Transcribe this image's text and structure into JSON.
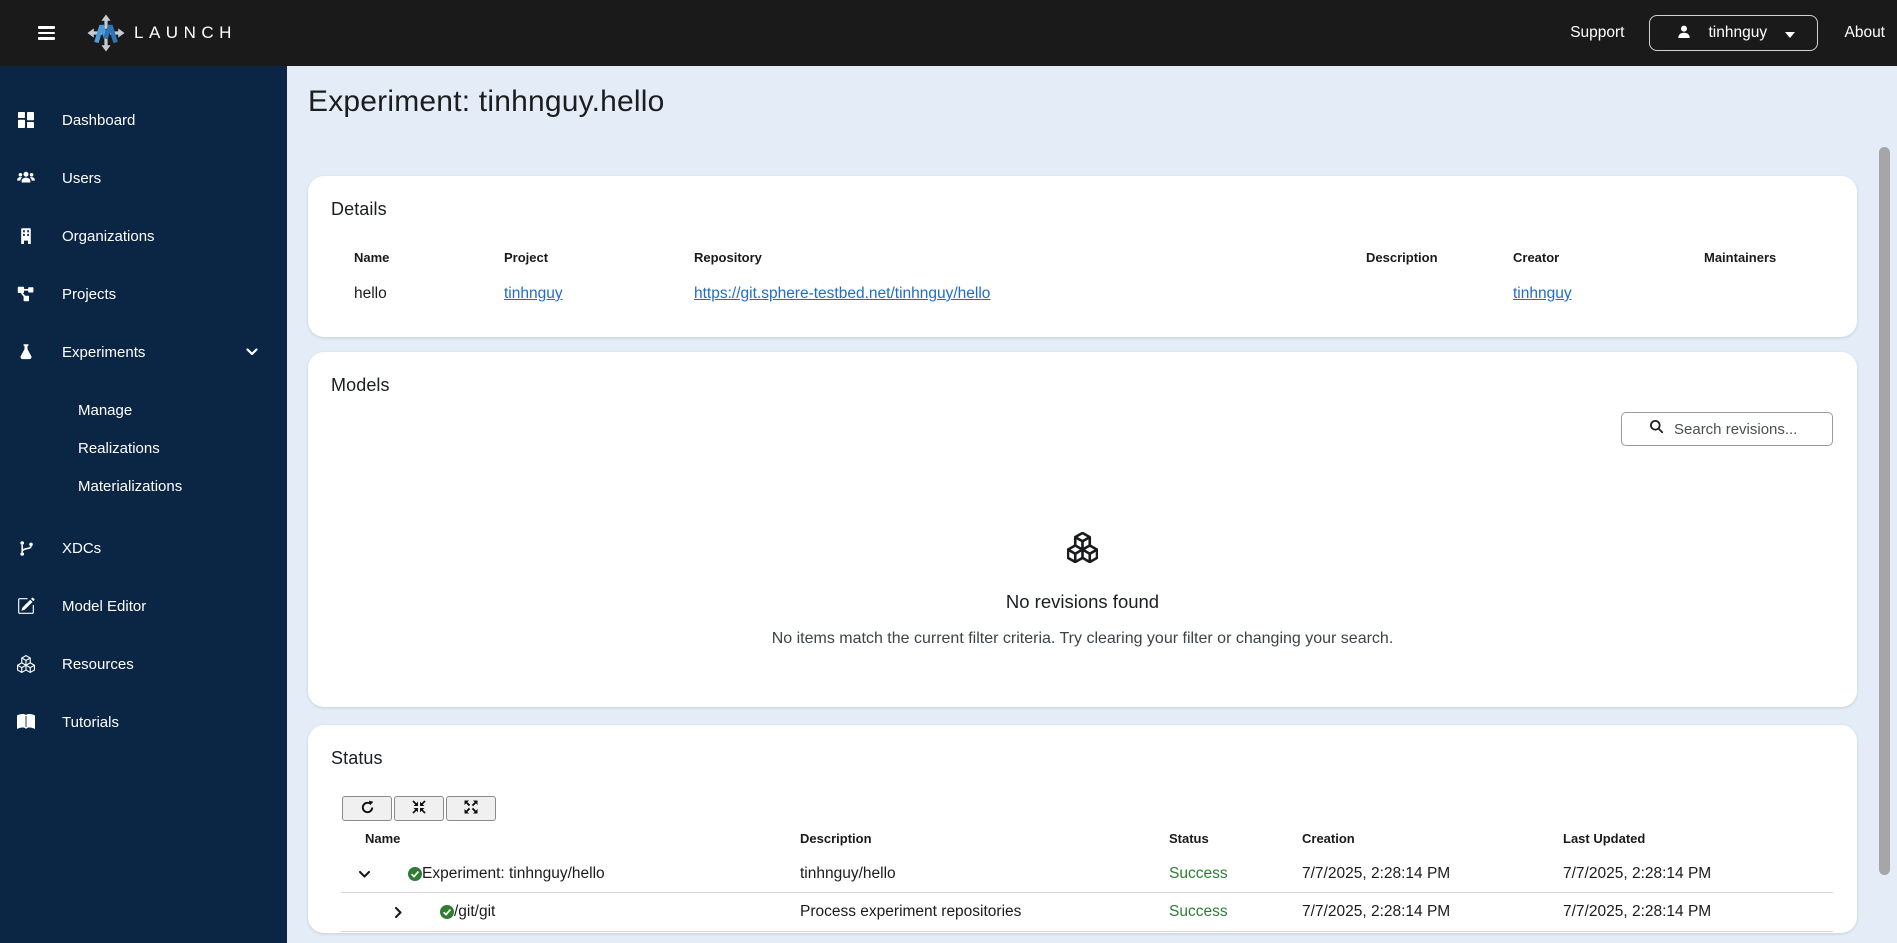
{
  "colors": {
    "brand_navy": "#0b2544",
    "topbar_bg": "#1a1a1b",
    "page_bg": "#e4edf7",
    "link_blue": "#1f6dc9",
    "success_green": "#2e7d32",
    "logo_blue": "#3a87c8"
  },
  "topbar": {
    "brand": "LAUNCH",
    "support_label": "Support",
    "user_name": "tinhnguy",
    "about_label": "About"
  },
  "sidebar": {
    "items": [
      {
        "label": "Dashboard"
      },
      {
        "label": "Users"
      },
      {
        "label": "Organizations"
      },
      {
        "label": "Projects"
      },
      {
        "label": "Experiments",
        "expanded": true,
        "children": [
          {
            "label": "Manage"
          },
          {
            "label": "Realizations"
          },
          {
            "label": "Materializations"
          }
        ]
      },
      {
        "label": "XDCs"
      },
      {
        "label": "Model Editor"
      },
      {
        "label": "Resources"
      },
      {
        "label": "Tutorials"
      }
    ]
  },
  "page": {
    "title": "Experiment: tinhnguy.hello"
  },
  "details_card": {
    "title": "Details",
    "columns": [
      "Name",
      "Project",
      "Repository",
      "Description",
      "Creator",
      "Maintainers"
    ],
    "row": {
      "name": "hello",
      "project": "tinhnguy",
      "repository": "https://git.sphere-testbed.net/tinhnguy/hello",
      "description": "",
      "creator": "tinhnguy",
      "maintainers": ""
    }
  },
  "models_card": {
    "title": "Models",
    "search_placeholder": "Search revisions...",
    "empty_title": "No revisions found",
    "empty_message": "No items match the current filter criteria. Try clearing your filter or changing your search."
  },
  "status_card": {
    "title": "Status",
    "toolbar": [
      "refresh",
      "collapse-all",
      "expand-all"
    ],
    "columns": [
      "Name",
      "Description",
      "Status",
      "Creation",
      "Last Updated"
    ],
    "rows": [
      {
        "name": "Experiment: tinhnguy/hello",
        "description": "tinhnguy/hello",
        "status": "Success",
        "creation": "7/7/2025, 2:28:14 PM",
        "last_updated": "7/7/2025, 2:28:14 PM",
        "expanded": true,
        "level": 0
      },
      {
        "name": "/git/git",
        "description": "Process experiment repositories",
        "status": "Success",
        "creation": "7/7/2025, 2:28:14 PM",
        "last_updated": "7/7/2025, 2:28:14 PM",
        "expanded": false,
        "level": 1
      }
    ]
  }
}
